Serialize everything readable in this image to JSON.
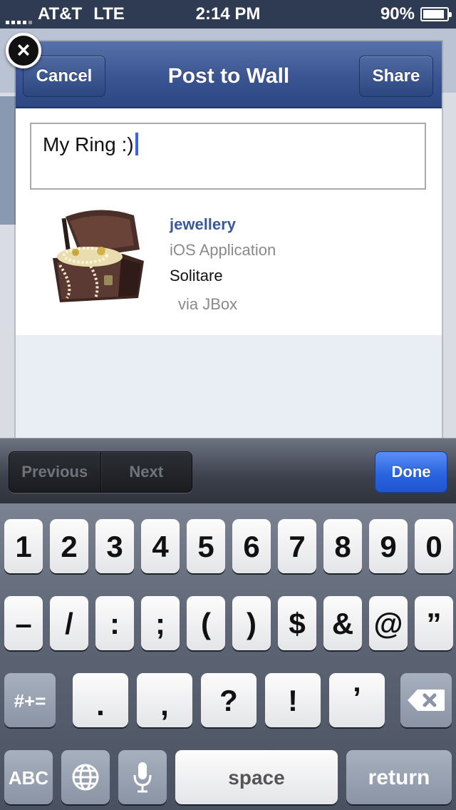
{
  "status_bar": {
    "carrier": "AT&T",
    "network": "LTE",
    "time": "2:14 PM",
    "battery": "90%",
    "battery_level": 0.9
  },
  "dialog": {
    "title": "Post to Wall",
    "cancel_label": "Cancel",
    "share_label": "Share",
    "message": "My Ring :)",
    "attachment": {
      "title": "jewellery",
      "type": "iOS Application",
      "description": "Solitare",
      "via": "via JBox"
    }
  },
  "toolbar": {
    "previous_label": "Previous",
    "next_label": "Next",
    "done_label": "Done"
  },
  "keyboard": {
    "row1": [
      "1",
      "2",
      "3",
      "4",
      "5",
      "6",
      "7",
      "8",
      "9",
      "0"
    ],
    "row2": [
      "–",
      "/",
      ":",
      ";",
      "(",
      ")",
      "$",
      "&",
      "@",
      "”"
    ],
    "row3": [
      ".",
      ",",
      "?",
      "!",
      "’"
    ],
    "shift_label": "#+=",
    "abc_label": "ABC",
    "space_label": "space",
    "return_label": "return"
  },
  "colors": {
    "accent_blue": "#3b5998",
    "done_blue": "#2a64e0",
    "caret": "#3c63e5"
  }
}
